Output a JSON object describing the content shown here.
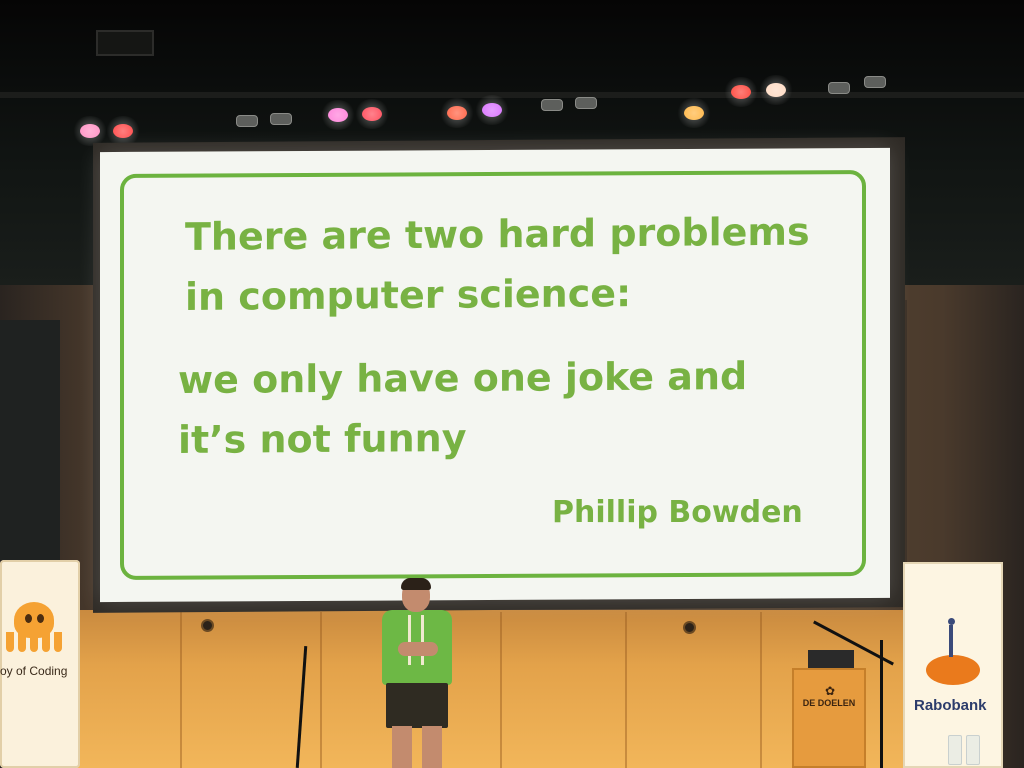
{
  "scene": {
    "description_free": true,
    "palette": {
      "slide_green": "#78b243",
      "slide_background": "#f4f6f1",
      "stage_orange": "#e3a24a",
      "shirt_green": "#6db845",
      "rabobank_orange": "#ea7a1c",
      "rabobank_blue": "#2c3c6b"
    }
  },
  "slide": {
    "quote_line_1": "There are two hard problems",
    "quote_line_2": "in computer science:",
    "quote_line_3": "we only have one joke and",
    "quote_line_4": "it’s not funny",
    "author": "Phillip Bowden"
  },
  "banners": {
    "left_text": "oy of Coding",
    "right_text": "Rabobank"
  },
  "lectern": {
    "text": "DE DOELEN",
    "logo_icon": "de-doelen-logo-icon"
  },
  "lights": {
    "colors": [
      "#ff6fa8",
      "#ff3b3b",
      "#ff6fd0",
      "#ff4050",
      "#ff4a3a",
      "#d86bff",
      "#ffb23a",
      "#ff3b30",
      "#ffd9c0"
    ]
  }
}
